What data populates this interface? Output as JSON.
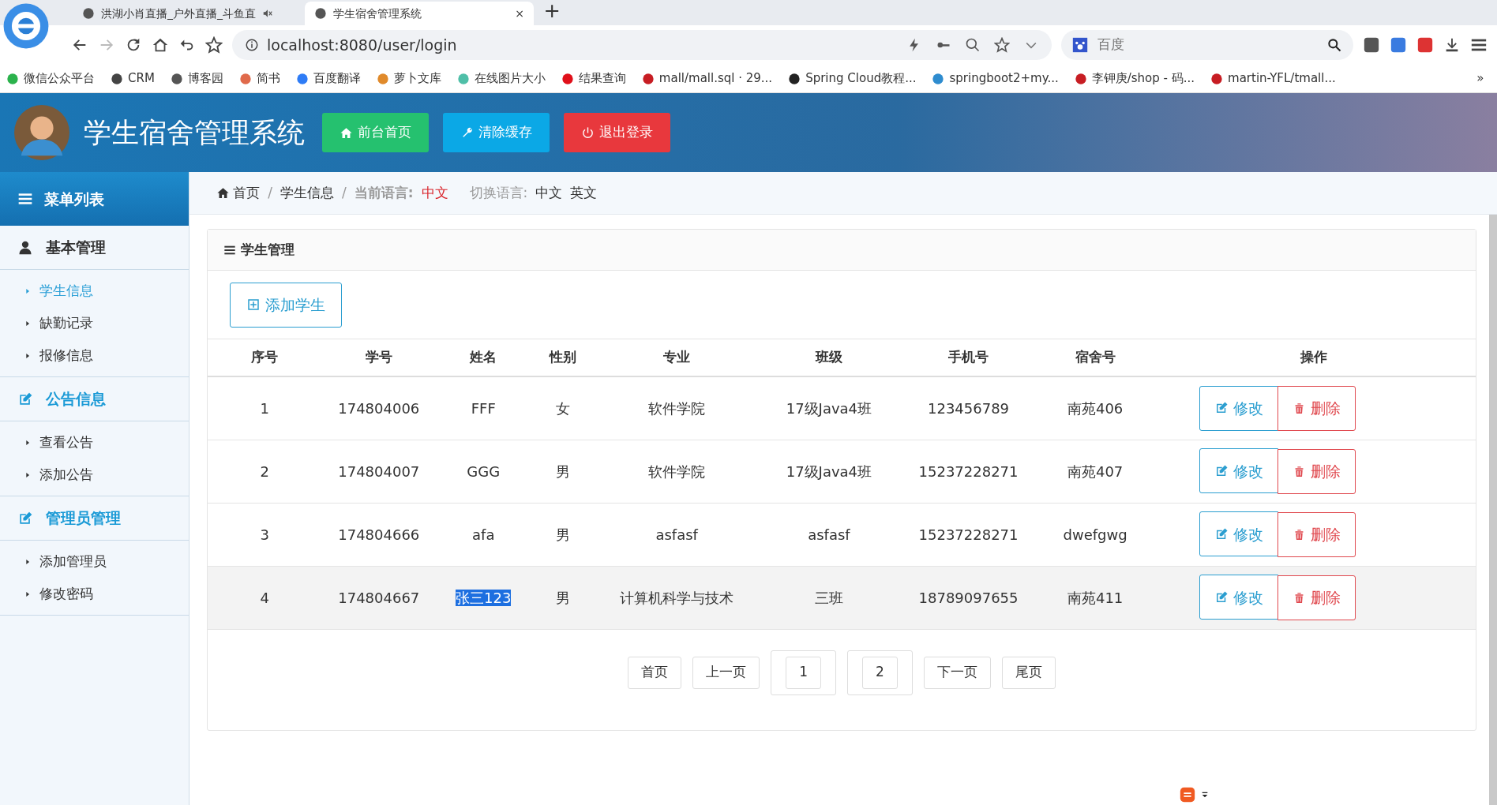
{
  "browser": {
    "tabs": [
      {
        "title": "洪湖小肖直播_户外直播_斗鱼直",
        "selected": false,
        "muted": true
      },
      {
        "title": "学生宿舍管理系统",
        "selected": true,
        "muted": false
      }
    ],
    "close_tab": "×",
    "new_tab": "+",
    "address": "localhost:8080/user/login",
    "search": {
      "placeholder": "百度"
    },
    "bookmarks": [
      {
        "label": "微信公众平台",
        "color": "#2bb24c"
      },
      {
        "label": "CRM",
        "color": "#444444"
      },
      {
        "label": "博客园",
        "color": "#555555"
      },
      {
        "label": "简书",
        "color": "#e06a4b"
      },
      {
        "label": "百度翻译",
        "color": "#2e7cf6"
      },
      {
        "label": "萝卜文库",
        "color": "#e08a2b"
      },
      {
        "label": "在线图片大小",
        "color": "#4fbfa8"
      },
      {
        "label": "结果查询",
        "color": "#e0101a"
      },
      {
        "label": "mall/mall.sql · 29...",
        "color": "#c71d23"
      },
      {
        "label": "Spring Cloud教程...",
        "color": "#222222"
      },
      {
        "label": "springboot2+my...",
        "color": "#2e8ccf"
      },
      {
        "label": "李钾庚/shop - 码...",
        "color": "#c71d23"
      },
      {
        "label": "martin-YFL/tmall...",
        "color": "#c71d23"
      }
    ],
    "more": "»"
  },
  "header": {
    "title": "学生宿舍管理系统",
    "buttons": [
      {
        "label": "前台首页",
        "kind": "home"
      },
      {
        "label": "清除缓存",
        "kind": "wrench"
      },
      {
        "label": "退出登录",
        "kind": "power"
      }
    ]
  },
  "sidebar": {
    "title": "菜单列表",
    "sections": [
      {
        "title": "基本管理",
        "kind": "user",
        "items": [
          {
            "label": "学生信息",
            "selected": true
          },
          {
            "label": "缺勤记录",
            "selected": false
          },
          {
            "label": "报修信息",
            "selected": false
          }
        ]
      },
      {
        "title": "公告信息",
        "kind": "edit",
        "items": [
          {
            "label": "查看公告",
            "selected": false
          },
          {
            "label": "添加公告",
            "selected": false
          }
        ]
      },
      {
        "title": "管理员管理",
        "kind": "edit",
        "items": [
          {
            "label": "添加管理员",
            "selected": false
          },
          {
            "label": "修改密码",
            "selected": false
          }
        ]
      }
    ]
  },
  "breadcrumb": {
    "items": [
      "首页",
      "学生信息"
    ],
    "separators": [
      "/",
      "/"
    ],
    "current_language_label": "当前语言:",
    "current_language": "中文",
    "switch_label": "切换语言:",
    "languages": [
      "中文",
      "英文"
    ]
  },
  "panel": {
    "title": "学生管理",
    "add_button": "添加学生",
    "table": {
      "columns": [
        "序号",
        "学号",
        "姓名",
        "性别",
        "专业",
        "班级",
        "手机号",
        "宿舍号",
        "操作"
      ],
      "rows": [
        {
          "cells": [
            "1",
            "174804006",
            "FFF",
            "女",
            "软件学院",
            "17级Java4班",
            "123456789",
            "南苑406"
          ],
          "actions": [
            "修改",
            "删除"
          ],
          "highlighted": false,
          "name_selected": false
        },
        {
          "cells": [
            "2",
            "174804007",
            "GGG",
            "男",
            "软件学院",
            "17级Java4班",
            "15237228271",
            "南苑407"
          ],
          "actions": [
            "修改",
            "删除"
          ],
          "highlighted": false,
          "name_selected": false
        },
        {
          "cells": [
            "3",
            "174804666",
            "afa",
            "男",
            "asfasf",
            "asfasf",
            "15237228271",
            "dwefgwg"
          ],
          "actions": [
            "修改",
            "删除"
          ],
          "highlighted": false,
          "name_selected": false
        },
        {
          "cells": [
            "4",
            "174804667",
            "张三123",
            "男",
            "计算机科学与技术",
            "三班",
            "18789097655",
            "南苑411"
          ],
          "actions": [
            "修改",
            "删除"
          ],
          "highlighted": true,
          "name_selected": true
        }
      ]
    },
    "pagination": [
      {
        "label": "首页",
        "kind": "nav"
      },
      {
        "label": "上一页",
        "kind": "nav"
      },
      {
        "label": "1",
        "kind": "page"
      },
      {
        "label": "2",
        "kind": "page"
      },
      {
        "label": "下一页",
        "kind": "nav"
      },
      {
        "label": "尾页",
        "kind": "nav"
      }
    ]
  }
}
